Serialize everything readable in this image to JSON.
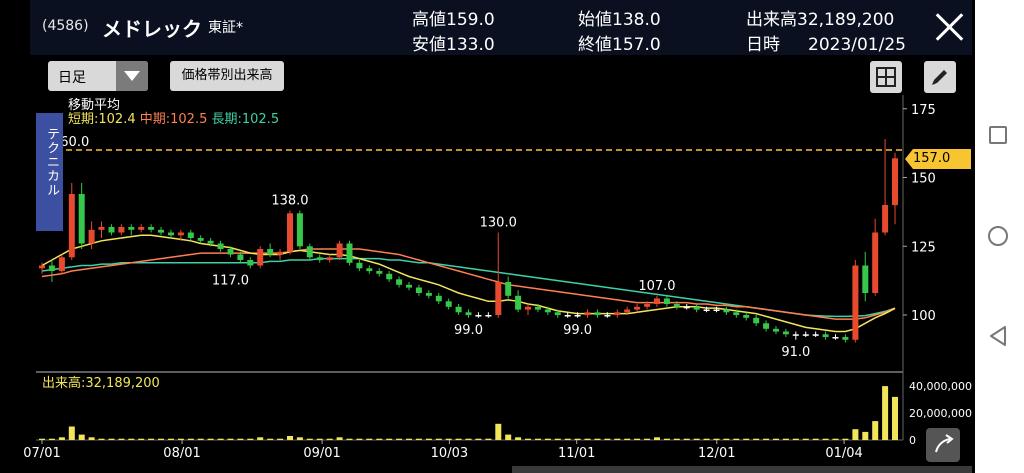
{
  "header": {
    "code": "(4586)",
    "name": "メドレック",
    "market": "東証*",
    "stats": {
      "high_label": "高値",
      "high_value": "159.0",
      "low_label": "安値",
      "low_value": "133.0",
      "open_label": "始値",
      "open_value": "138.0",
      "close_label": "終値",
      "close_value": "157.0",
      "volume_label": "出来高",
      "volume_value": "32,189,200",
      "date_label": "日時",
      "date_value": "2023/01/25"
    }
  },
  "toolbar": {
    "period_value": "日足",
    "volume_by_price_label": "価格帯別出来高"
  },
  "overlay": {
    "technical_tab": "テクニカル",
    "ma_title": "移動平均",
    "ma_short": "短期:102.4",
    "ma_mid": "中期:102.5",
    "ma_long": "長期:102.5",
    "volume_label": "出来高:32,189,200",
    "current_price_flag": "157.0",
    "ref_line_label": "160.0"
  },
  "colors": {
    "up": "#e84a2f",
    "down": "#35c84a",
    "ma_short": "#f2e55a",
    "ma_mid": "#ff7f50",
    "ma_long": "#3fd0a8",
    "volume": "#f2e55a",
    "price_flag": "#f7c531"
  },
  "chart_data": {
    "type": "candlestick",
    "y_ticks": [
      "175",
      "150",
      "125",
      "100"
    ],
    "volume_ticks": [
      "40,000,000",
      "20,000,000",
      "0"
    ],
    "x_ticks": [
      "07/01",
      "08/01",
      "09/01",
      "10/03",
      "11/01",
      "12/01",
      "01/04"
    ],
    "price_annotations": [
      {
        "label": "138.0",
        "x": "08/22",
        "price": 138
      },
      {
        "label": "117.0",
        "x": "08/10",
        "price": 117
      },
      {
        "label": "130.0",
        "x": "10/03",
        "price": 130
      },
      {
        "label": "99.0",
        "x": "10/03",
        "price": 99
      },
      {
        "label": "99.0",
        "x": "11/01",
        "price": 99
      },
      {
        "label": "107.0",
        "x": "11/17",
        "price": 107
      },
      {
        "label": "91.0",
        "x": "12/20",
        "price": 91
      }
    ],
    "current_price": 157.0,
    "ohlc": [
      [
        117,
        119,
        115,
        118
      ],
      [
        118,
        120,
        112,
        116
      ],
      [
        116,
        122,
        115,
        121
      ],
      [
        121,
        148,
        120,
        144
      ],
      [
        144,
        148,
        124,
        126
      ],
      [
        126,
        134,
        124,
        131
      ],
      [
        131,
        134,
        128,
        132
      ],
      [
        132,
        133,
        129,
        130
      ],
      [
        130,
        133,
        129,
        132
      ],
      [
        132,
        133,
        129,
        131
      ],
      [
        131,
        133,
        130,
        132
      ],
      [
        132,
        133,
        130,
        131
      ],
      [
        131,
        132,
        129,
        130
      ],
      [
        130,
        131,
        128,
        129
      ],
      [
        129,
        131,
        127,
        130
      ],
      [
        130,
        131,
        127,
        128
      ],
      [
        128,
        129,
        126,
        127
      ],
      [
        127,
        128,
        125,
        126
      ],
      [
        126,
        127,
        123,
        124
      ],
      [
        124,
        125,
        121,
        122
      ],
      [
        122,
        123,
        119,
        120
      ],
      [
        120,
        121,
        117,
        118
      ],
      [
        118,
        125,
        117,
        124
      ],
      [
        124,
        126,
        121,
        122
      ],
      [
        122,
        124,
        120,
        123
      ],
      [
        123,
        138,
        122,
        137
      ],
      [
        137,
        138,
        124,
        125
      ],
      [
        125,
        126,
        120,
        121
      ],
      [
        121,
        122,
        119,
        120
      ],
      [
        120,
        122,
        119,
        121
      ],
      [
        121,
        127,
        120,
        126
      ],
      [
        126,
        127,
        118,
        119
      ],
      [
        119,
        120,
        116,
        117
      ],
      [
        117,
        118,
        115,
        116
      ],
      [
        116,
        117,
        114,
        115
      ],
      [
        115,
        116,
        112,
        113
      ],
      [
        113,
        114,
        110,
        111
      ],
      [
        111,
        112,
        109,
        110
      ],
      [
        110,
        111,
        107,
        108
      ],
      [
        108,
        109,
        106,
        107
      ],
      [
        107,
        108,
        104,
        105
      ],
      [
        105,
        106,
        102,
        103
      ],
      [
        103,
        104,
        100,
        101
      ],
      [
        101,
        102,
        99,
        100
      ],
      [
        100,
        101,
        99,
        100
      ],
      [
        100,
        101,
        99,
        100
      ],
      [
        100,
        130,
        99,
        112
      ],
      [
        112,
        114,
        106,
        107
      ],
      [
        107,
        109,
        101,
        102
      ],
      [
        102,
        104,
        100,
        103
      ],
      [
        103,
        104,
        101,
        102
      ],
      [
        102,
        103,
        100,
        101
      ],
      [
        101,
        102,
        99,
        100
      ],
      [
        100,
        101,
        99,
        100
      ],
      [
        100,
        101,
        99,
        100
      ],
      [
        100,
        102,
        99,
        101
      ],
      [
        101,
        102,
        99,
        100
      ],
      [
        100,
        101,
        99,
        100
      ],
      [
        100,
        102,
        99,
        101
      ],
      [
        101,
        103,
        100,
        102
      ],
      [
        102,
        104,
        101,
        103
      ],
      [
        103,
        105,
        102,
        104
      ],
      [
        104,
        107,
        103,
        106
      ],
      [
        106,
        107,
        103,
        104
      ],
      [
        104,
        105,
        102,
        103
      ],
      [
        103,
        104,
        102,
        103
      ],
      [
        103,
        104,
        101,
        102
      ],
      [
        102,
        103,
        101,
        102
      ],
      [
        102,
        103,
        101,
        102
      ],
      [
        102,
        103,
        100,
        101
      ],
      [
        101,
        102,
        99,
        100
      ],
      [
        100,
        101,
        98,
        99
      ],
      [
        99,
        100,
        96,
        97
      ],
      [
        97,
        98,
        94,
        95
      ],
      [
        95,
        96,
        93,
        94
      ],
      [
        94,
        95,
        92,
        93
      ],
      [
        93,
        94,
        91,
        93
      ],
      [
        93,
        94,
        92,
        93
      ],
      [
        93,
        94,
        92,
        93
      ],
      [
        93,
        94,
        91,
        92
      ],
      [
        92,
        93,
        91,
        92
      ],
      [
        92,
        93,
        90,
        91
      ],
      [
        91,
        120,
        90,
        118
      ],
      [
        118,
        123,
        105,
        108
      ],
      [
        108,
        135,
        107,
        130
      ],
      [
        130,
        164,
        129,
        140
      ],
      [
        140,
        159,
        133,
        157
      ]
    ],
    "volume_millions": [
      1,
      1,
      2,
      10,
      4,
      2,
      1,
      1,
      1,
      1,
      1,
      1,
      1,
      1,
      1,
      1,
      1,
      1,
      1,
      1,
      1,
      1,
      2,
      1,
      1,
      3,
      2,
      1,
      1,
      1,
      2,
      1,
      1,
      1,
      1,
      1,
      1,
      1,
      1,
      1,
      1,
      1,
      1,
      1,
      1,
      1,
      12,
      4,
      2,
      1,
      1,
      1,
      1,
      1,
      1,
      1,
      1,
      1,
      1,
      1,
      1,
      1,
      2,
      1,
      1,
      1,
      1,
      1,
      1,
      1,
      1,
      1,
      1,
      1,
      1,
      1,
      1,
      1,
      1,
      1,
      1,
      1,
      8,
      6,
      14,
      40,
      32
    ],
    "ma_short": [
      118,
      120,
      122,
      124,
      125,
      126,
      127,
      127.5,
      128,
      128.5,
      129,
      129,
      128.5,
      128,
      127.5,
      127,
      126,
      125.5,
      125,
      124.5,
      123.5,
      122.5,
      122,
      122,
      122,
      123,
      123.5,
      123,
      122.5,
      122,
      122,
      121.5,
      120.5,
      119.5,
      118.5,
      117,
      115.5,
      114,
      113,
      112,
      111,
      109.5,
      108,
      107,
      106,
      105,
      105,
      105.5,
      105,
      104,
      103.5,
      102.5,
      101.5,
      101,
      100.5,
      100.5,
      100.5,
      100.5,
      100.5,
      100.5,
      101,
      101.5,
      102,
      102.5,
      103,
      103,
      103,
      102.5,
      102.5,
      102,
      101.5,
      101,
      100.5,
      99.5,
      98.5,
      97.5,
      96.5,
      95.5,
      95,
      94.5,
      94,
      94,
      95,
      97,
      99,
      100.5,
      102.4
    ],
    "ma_mid": [
      114,
      114.5,
      115,
      116,
      116.5,
      117,
      117.5,
      118,
      118.5,
      119,
      119.5,
      120,
      120.5,
      121,
      121.5,
      122,
      122.5,
      122.5,
      122.5,
      122.5,
      122.5,
      122.5,
      122.5,
      122.5,
      122.5,
      123,
      123.5,
      124,
      124,
      124,
      124,
      124,
      124,
      123.5,
      123,
      122.5,
      122,
      121,
      120,
      119,
      118,
      117,
      116,
      115,
      114,
      113,
      112,
      111,
      110.5,
      110,
      109.5,
      109,
      108.5,
      108,
      107.5,
      107,
      106.5,
      106,
      105.5,
      105,
      104.5,
      104.5,
      104.5,
      104.5,
      104.5,
      104.5,
      104,
      104,
      103.5,
      103.5,
      103,
      103,
      102.5,
      102,
      101.5,
      101,
      100.5,
      100,
      99.5,
      99,
      98.5,
      98.5,
      98.5,
      99,
      100,
      101,
      102.5
    ],
    "ma_long": [
      116,
      116.5,
      117,
      117.5,
      118,
      118,
      118.5,
      118.5,
      119,
      119,
      119,
      119,
      119,
      119,
      119,
      119,
      119,
      119,
      119,
      119,
      119,
      119,
      119,
      119.5,
      119.5,
      120,
      120,
      120,
      120.5,
      120.5,
      120.5,
      120.5,
      120.5,
      120.5,
      120.5,
      120,
      120,
      119.5,
      119,
      119,
      118.5,
      118,
      117.5,
      117,
      116.5,
      116,
      115.5,
      115,
      114.5,
      114,
      113.5,
      113,
      112.5,
      112,
      111.5,
      111,
      110.5,
      110,
      109.5,
      109,
      108.5,
      108,
      107.5,
      107,
      106.5,
      106,
      105.5,
      105,
      104.5,
      104,
      103.5,
      103,
      102.5,
      102,
      101.5,
      101,
      100.5,
      100,
      99.8,
      99.6,
      99.5,
      99.5,
      99.6,
      99.8,
      100.5,
      101.3,
      102.5
    ]
  }
}
